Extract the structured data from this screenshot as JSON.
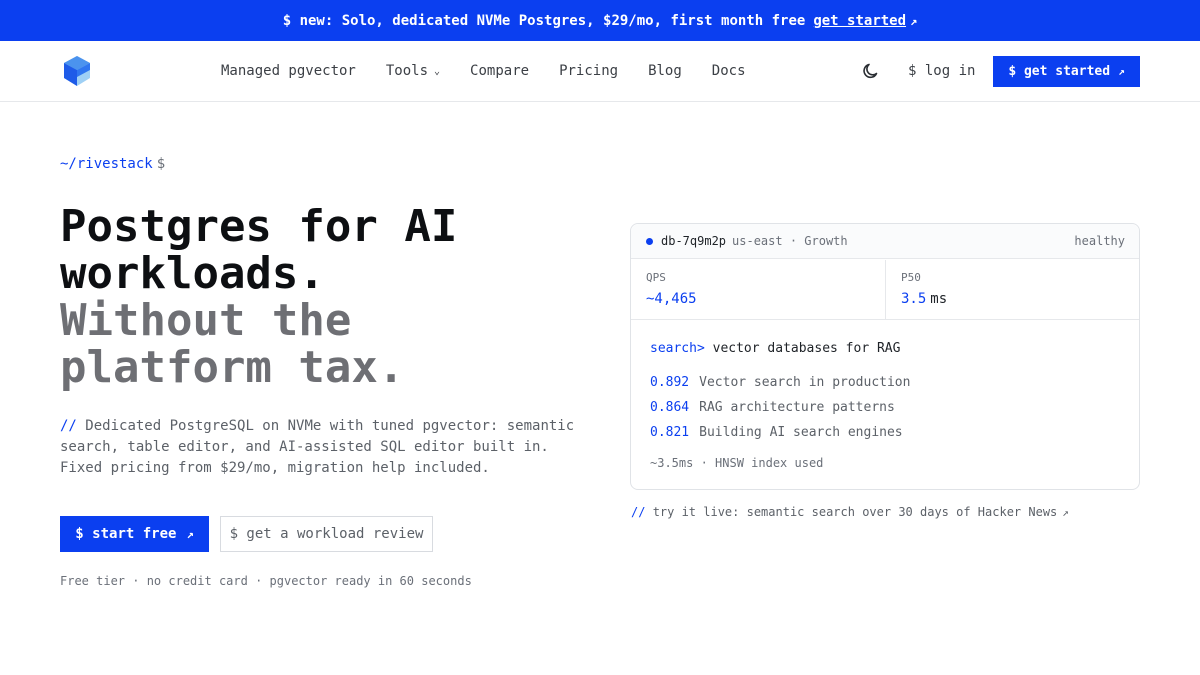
{
  "banner": {
    "text": "$ new: Solo, dedicated NVMe Postgres, $29/mo, first month free",
    "link_label": "get started",
    "link_arrow": "↗"
  },
  "nav": {
    "logo_icon": "rivestack-logo-icon",
    "links": [
      {
        "label": "Managed pgvector"
      },
      {
        "label": "Tools",
        "chevron": "⌄"
      },
      {
        "label": "Compare"
      },
      {
        "label": "Pricing"
      },
      {
        "label": "Blog"
      },
      {
        "label": "Docs"
      }
    ],
    "theme_icon": "moon-icon",
    "login_label": "$ log in",
    "cta_label": "$ get started",
    "cta_arrow": "↗"
  },
  "hero": {
    "prompt_path": "~/rivestack",
    "prompt_symbol": "$",
    "title_line1": "Postgres for AI",
    "title_line2": "workloads.",
    "title_line3": "Without the",
    "title_line4": "platform tax.",
    "desc_prefix": "//",
    "description": "Dedicated PostgreSQL on NVMe with tuned pgvector: semantic search, table editor, and AI-assisted SQL editor built in. Fixed pricing from $29/mo, migration help included.",
    "primary_label": "$ start free",
    "primary_arrow": "↗",
    "secondary_label": "$ get a workload review",
    "footnote": "Free tier · no credit card · pgvector ready in 60 seconds"
  },
  "card": {
    "db_id": "db-7q9m2p",
    "db_region": "us-east · Growth",
    "db_status": "healthy",
    "metric1_label": "QPS",
    "metric1_value": "~4,465",
    "metric2_label": "P50",
    "metric2_value": "3.5",
    "metric2_unit": "ms",
    "query_prompt": "search>",
    "query_text": "vector databases for RAG",
    "results": [
      {
        "score": "0.892",
        "title": "Vector search in production"
      },
      {
        "score": "0.864",
        "title": "RAG architecture patterns"
      },
      {
        "score": "0.821",
        "title": "Building AI search engines"
      }
    ],
    "footer": "~3.5ms · HNSW index used"
  },
  "try_live": {
    "prefix": "//",
    "label": "try it live: semantic search over 30 days of Hacker News",
    "arrow": "↗"
  },
  "colors": {
    "accent": "#0b3ff0",
    "muted_heading": "#6e6f74"
  }
}
